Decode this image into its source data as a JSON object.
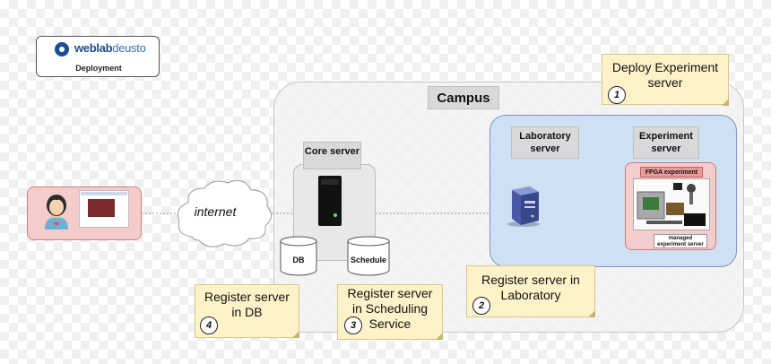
{
  "logo": {
    "brand_bold": "weblab",
    "brand_light": "deusto",
    "subtitle": "Deployment"
  },
  "campus": {
    "label": "Campus"
  },
  "laboratory": {
    "label": "Laboratory server"
  },
  "experiment": {
    "label": "Experiment server",
    "fpga_label": "FPGA experiment",
    "managed_label": "managed experiment server"
  },
  "core": {
    "label": "Core server",
    "db_label": "DB",
    "schedule_label": "Schedule"
  },
  "internet": {
    "label": "internet"
  },
  "notes": {
    "n1": {
      "text": "Deploy Experiment server",
      "number": "1"
    },
    "n2": {
      "text": "Register server in Laboratory",
      "number": "2"
    },
    "n3": {
      "text": "Register server in Scheduling Service",
      "number": "3"
    },
    "n4": {
      "text": "Register server in DB",
      "number": "4"
    }
  }
}
